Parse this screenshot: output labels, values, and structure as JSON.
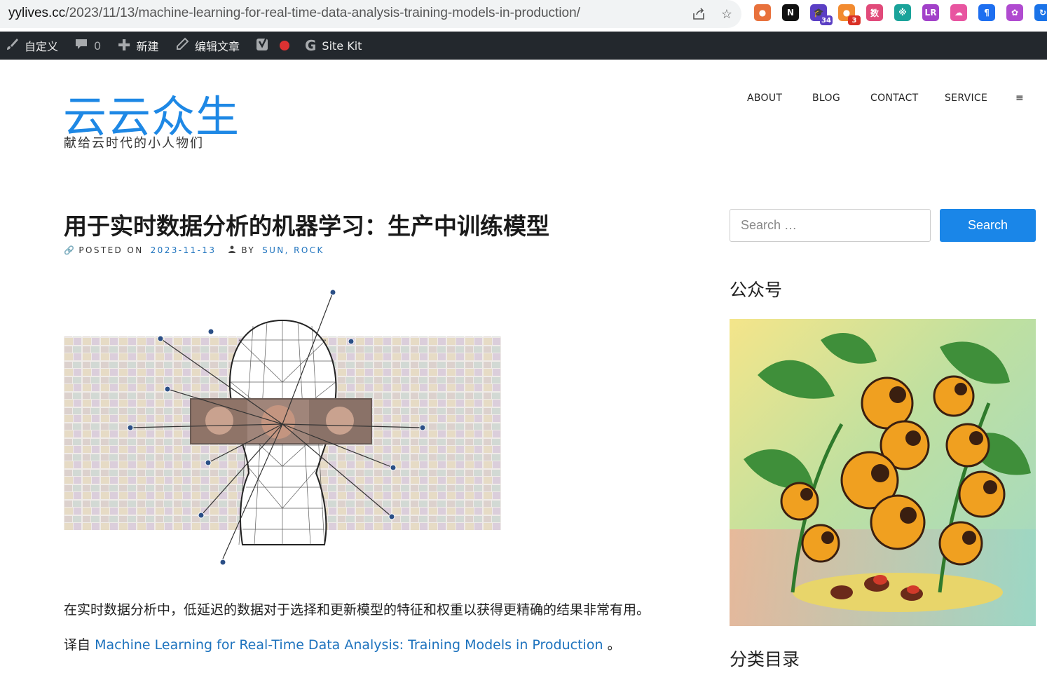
{
  "browser": {
    "url_host": "yylives.cc",
    "url_path": "/2023/11/13/machine-learning-for-real-time-data-analysis-training-models-in-production/",
    "extensions": [
      {
        "icon": "chrome-circle-ext-icon",
        "color": "#e8713c",
        "glyph": "●"
      },
      {
        "icon": "notion-ext-icon",
        "color": "#111111",
        "glyph": "N"
      },
      {
        "icon": "graduation-cap-ext-icon",
        "color": "#5b3fc4",
        "glyph": "🎓",
        "badge": "34",
        "badge_color": "#5b3fc4"
      },
      {
        "icon": "toggl-ext-icon",
        "color": "#f28b30",
        "glyph": "●",
        "badge": "3",
        "badge_color": "#d93025"
      },
      {
        "icon": "data-ext-icon",
        "color": "#e14a7a",
        "glyph": "数"
      },
      {
        "icon": "translate-ext-icon",
        "color": "#1aa39a",
        "glyph": "※"
      },
      {
        "icon": "lr-ext-icon",
        "color": "#a241c9",
        "glyph": "LR"
      },
      {
        "icon": "cloud-ext-icon",
        "color": "#e855a0",
        "glyph": "☁"
      },
      {
        "icon": "paragraph-ext-icon",
        "color": "#1e6ff0",
        "glyph": "¶"
      },
      {
        "icon": "openai-ext-icon",
        "color": "#b04bd0",
        "glyph": "✿"
      },
      {
        "icon": "refresh-ext-icon",
        "color": "#1a73e8",
        "glyph": "↻"
      }
    ]
  },
  "adminbar": {
    "customize": "自定义",
    "comments_count": "0",
    "new": "新建",
    "edit_post": "编辑文章",
    "site_kit": "Site Kit"
  },
  "header": {
    "site_title": "云云众生",
    "tagline": "献给云时代的小人物们",
    "nav": [
      "ABOUT",
      "BLOG",
      "CONTACT",
      "SERVICE",
      "≡"
    ]
  },
  "post": {
    "title": "用于实时数据分析的机器学习：生产中训练模型",
    "posted_on_label": "POSTED ON",
    "date": "2023-11-13",
    "by_label": "BY",
    "author": "SUN, ROCK",
    "para1": "在实时数据分析中，低延迟的数据对于选择和更新模型的特征和权重以获得更精确的结果非常有用。",
    "para2_prefix": "译自",
    "para2_link": "Machine Learning for Real-Time Data Analysis: Training Models in Production",
    "para2_suffix": "。"
  },
  "sidebar": {
    "search_placeholder": "Search …",
    "search_button": "Search",
    "widget1_title": "公众号",
    "widget2_title": "分类目录"
  }
}
